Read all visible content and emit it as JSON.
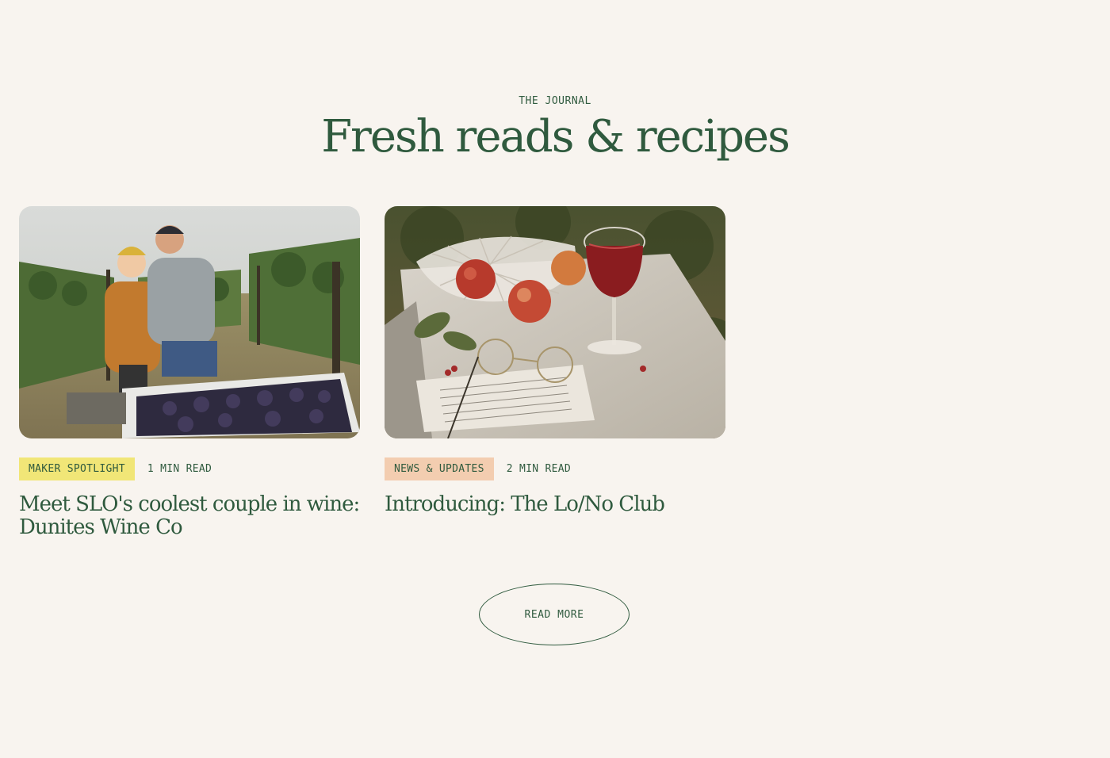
{
  "section": {
    "eyebrow": "THE JOURNAL",
    "title": "Fresh reads & recipes"
  },
  "articles": [
    {
      "tag": "MAKER SPOTLIGHT",
      "read_time": "1 MIN READ",
      "title": "Meet SLO's coolest couple in wine: Dunites Wine Co",
      "image": "couple-in-vineyard-photo",
      "tag_color": "#f1e677"
    },
    {
      "tag": "NEWS & UPDATES",
      "read_time": "2 MIN READ",
      "title": "Introducing: The Lo/No Club",
      "image": "wine-glass-apples-table-photo",
      "tag_color": "#f3cdb0"
    }
  ],
  "cta": {
    "label": "READ MORE"
  },
  "colors": {
    "background": "#f8f4ef",
    "primary_green": "#2f5a3e"
  }
}
